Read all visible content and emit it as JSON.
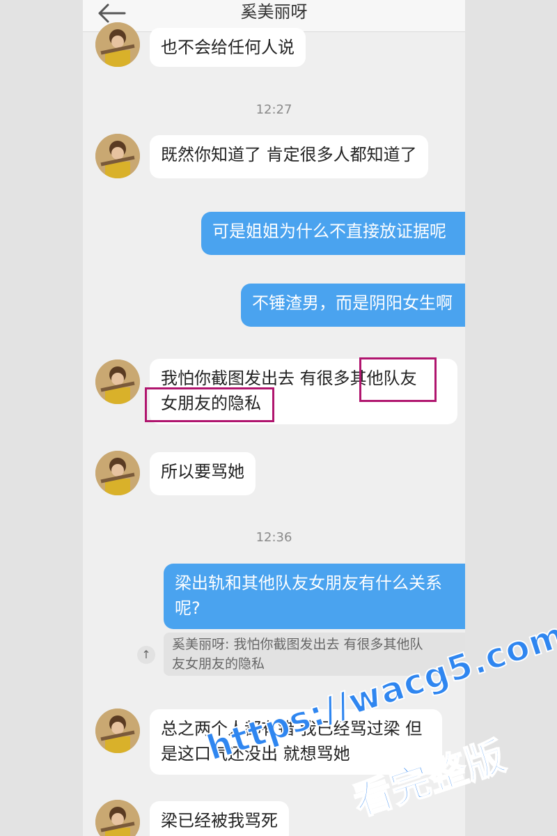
{
  "header": {
    "title": "奚美丽呀"
  },
  "chat": {
    "msg1": "也不会给任何人说",
    "time1": "12:27",
    "msg2": "既然你知道了 肯定很多人都知道了",
    "msg3": "可是姐姐为什么不直接放证据呢",
    "msg4": "不锤渣男，而是阴阳女生啊",
    "msg5_line1": "我怕你截图发出去 有很多其他队友",
    "msg5_line2": "女朋友的隐私",
    "msg6": "所以要骂她",
    "time2": "12:36",
    "msg7_line1": "梁出轨和其他队友女朋友有什么关系",
    "msg7_line2": "呢?",
    "quote_line1": "奚美丽呀: 我怕你截图发出去 有很多其他队",
    "quote_line2": "友女朋友的隐私",
    "msg8_line1": "总之两个人都有错 我已经骂过梁 但",
    "msg8_line2": "是这口气还没出 就想骂她",
    "msg9": "梁已经被我骂死"
  },
  "watermark": {
    "url": "https://wacg5.com",
    "text": "看完整版"
  },
  "colors": {
    "outgoing": "#4aa3ef",
    "incoming": "#ffffff",
    "highlight": "#b0156e",
    "watermark": "#2f86f0"
  }
}
